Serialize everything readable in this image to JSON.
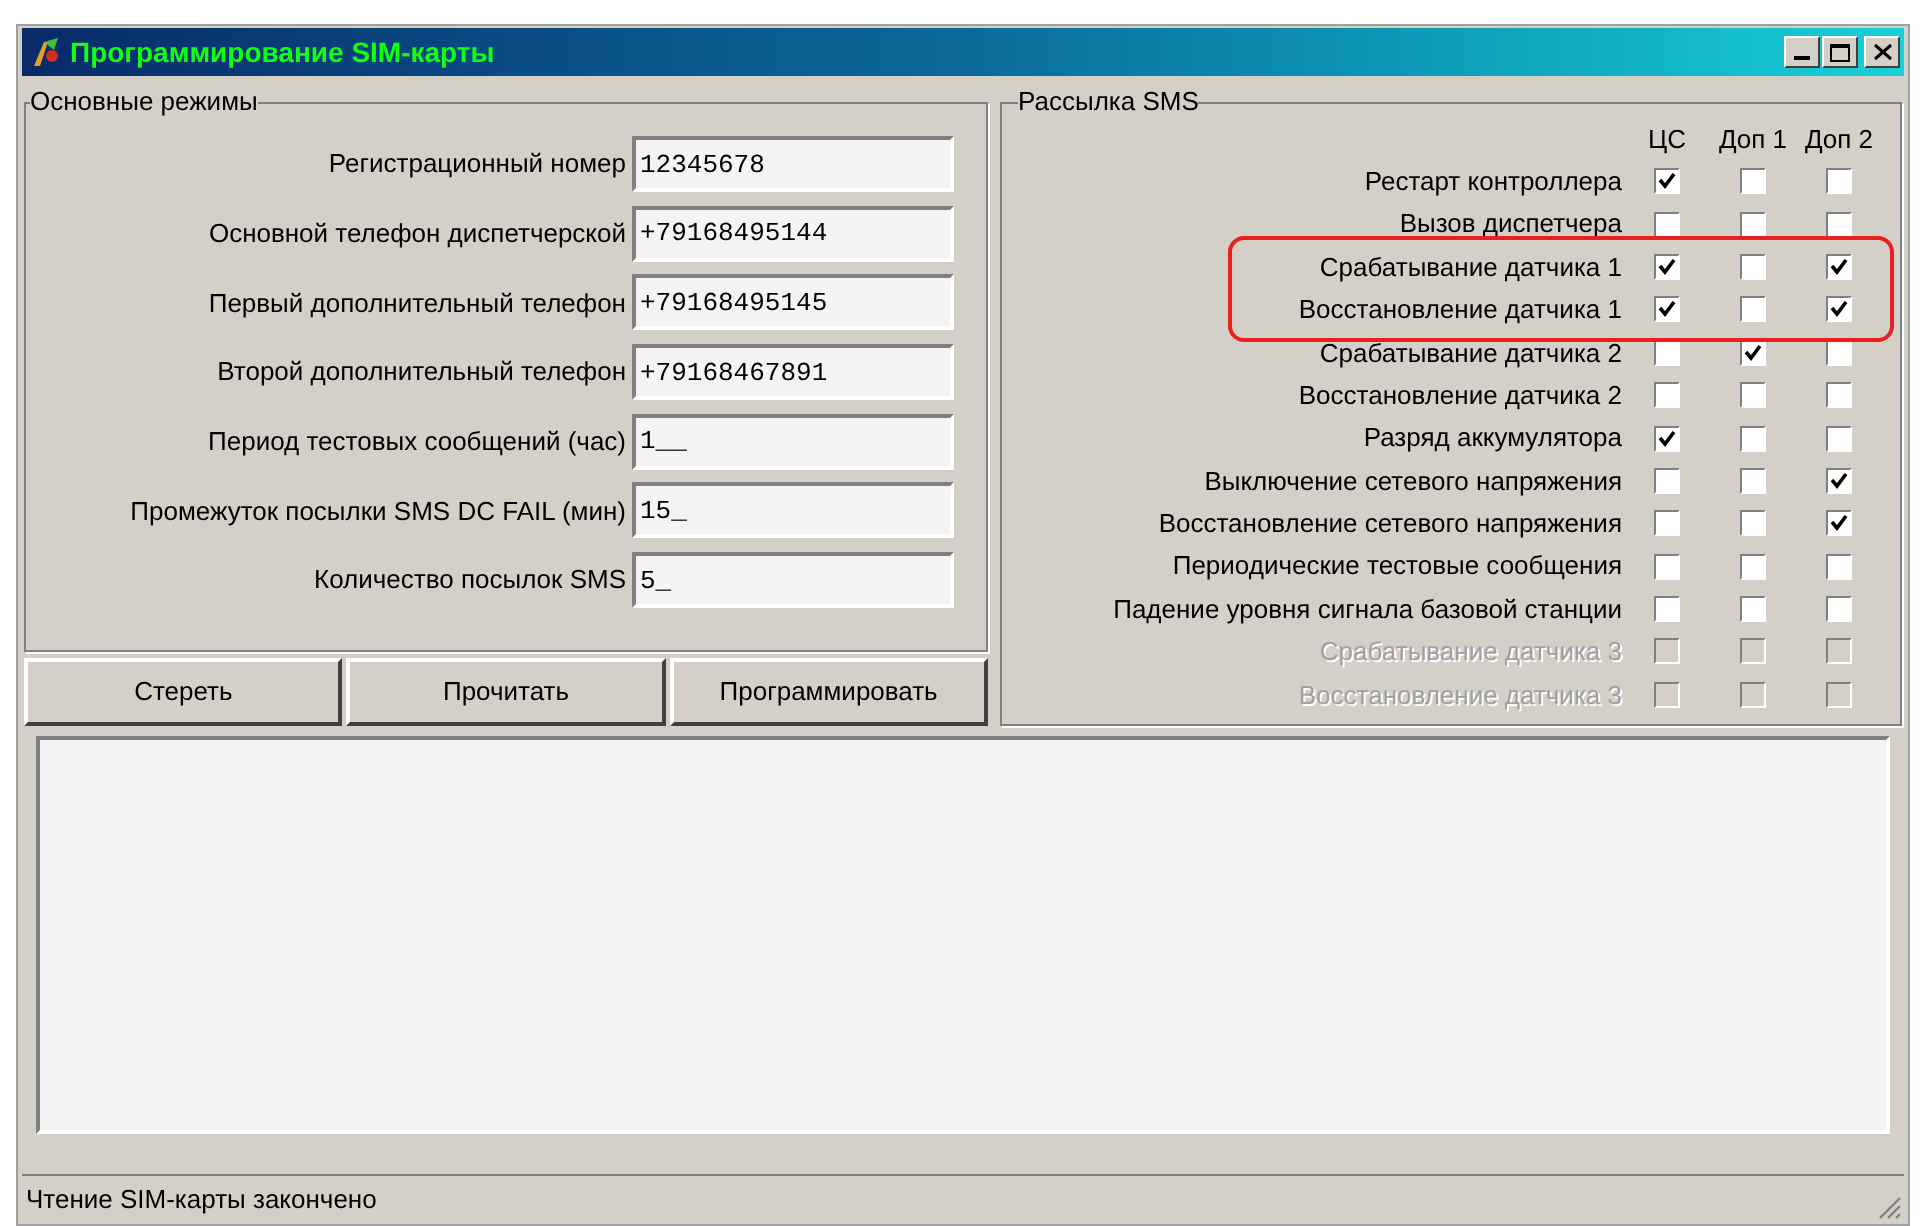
{
  "window": {
    "title": "Программирование SIM-карты"
  },
  "main_modes": {
    "title": "Основные режимы",
    "fields": [
      {
        "label": "Регистрационный номер",
        "value": "12345678"
      },
      {
        "label": "Основной телефон диспетчерской",
        "value": "+79168495144"
      },
      {
        "label": "Первый дополнительный телефон",
        "value": "+79168495145"
      },
      {
        "label": "Второй дополнительный телефон",
        "value": "+79168467891"
      },
      {
        "label": "Период тестовых сообщений (час)",
        "value": "1__"
      },
      {
        "label": "Промежуток посылки SMS DC FAIL (мин)",
        "value": "15_"
      },
      {
        "label": "Количество посылок SMS",
        "value": "5_"
      }
    ]
  },
  "buttons": [
    "Стереть",
    "Прочитать",
    "Программировать"
  ],
  "sms": {
    "title": "Рассылка SMS",
    "columns": [
      "ЦС",
      "Доп 1",
      "Доп 2"
    ],
    "rows": [
      {
        "label": "Рестарт контроллера",
        "disabled": false,
        "highlighted": false,
        "checks": [
          true,
          false,
          false
        ]
      },
      {
        "label": "Вызов диспетчера",
        "disabled": false,
        "highlighted": false,
        "checks": [
          false,
          false,
          false
        ]
      },
      {
        "label": "Срабатывание датчика 1",
        "disabled": false,
        "highlighted": true,
        "checks": [
          true,
          false,
          true
        ]
      },
      {
        "label": "Восстановление датчика 1",
        "disabled": false,
        "highlighted": true,
        "checks": [
          true,
          false,
          true
        ]
      },
      {
        "label": "Срабатывание датчика 2",
        "disabled": false,
        "highlighted": false,
        "checks": [
          false,
          true,
          false
        ]
      },
      {
        "label": "Восстановление датчика 2",
        "disabled": false,
        "highlighted": false,
        "checks": [
          false,
          false,
          false
        ]
      },
      {
        "label": "Разряд аккумулятора",
        "disabled": false,
        "highlighted": false,
        "checks": [
          true,
          false,
          false
        ]
      },
      {
        "label": "Выключение сетевого напряжения",
        "disabled": false,
        "highlighted": false,
        "checks": [
          false,
          false,
          true
        ]
      },
      {
        "label": "Восстановление сетевого напряжения",
        "disabled": false,
        "highlighted": false,
        "checks": [
          false,
          false,
          true
        ]
      },
      {
        "label": "Периодические тестовые сообщения",
        "disabled": false,
        "highlighted": false,
        "checks": [
          false,
          false,
          false
        ]
      },
      {
        "label": "Падение уровня сигнала базовой станции",
        "disabled": false,
        "highlighted": false,
        "checks": [
          false,
          false,
          false
        ]
      },
      {
        "label": "Срабатывание датчика 3",
        "disabled": true,
        "highlighted": false,
        "checks": [
          false,
          false,
          false
        ]
      },
      {
        "label": "Восстановление датчика 3",
        "disabled": true,
        "highlighted": false,
        "checks": [
          false,
          false,
          false
        ]
      }
    ]
  },
  "status_bar": "Чтение SIM-карты закончено"
}
